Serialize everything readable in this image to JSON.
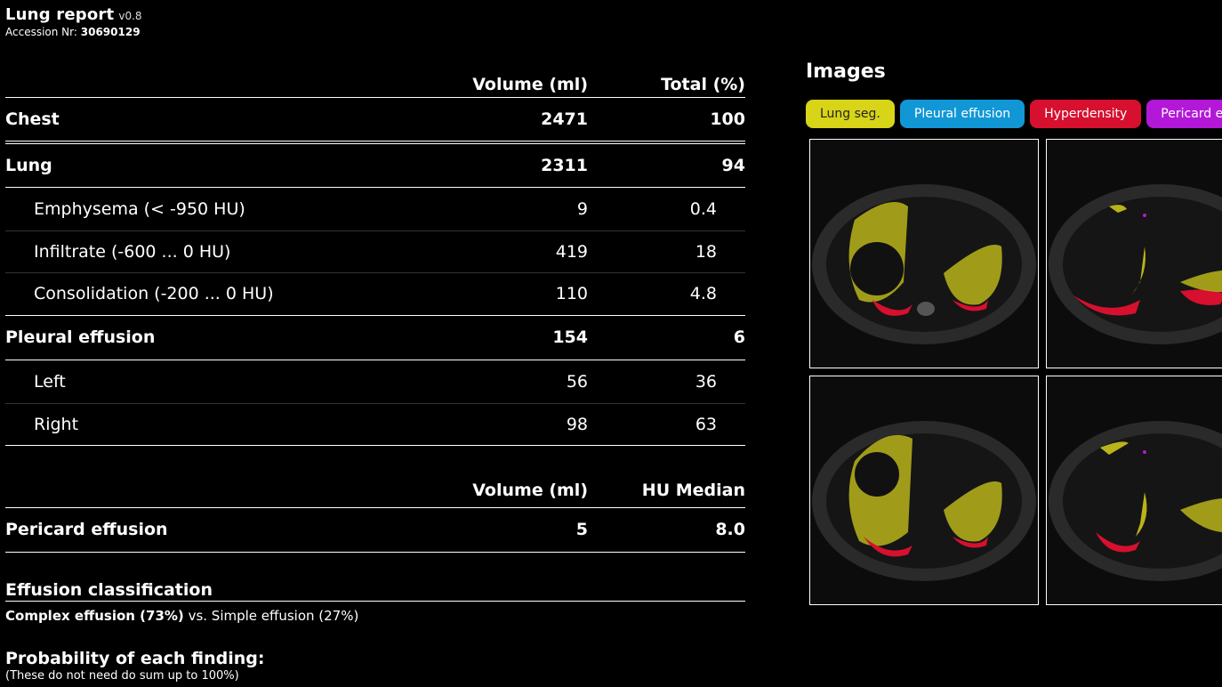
{
  "header": {
    "title": "Lung report",
    "version": "v0.8",
    "accession_label": "Accession Nr:",
    "accession_value": "30690129"
  },
  "volume_table": {
    "col_volume": "Volume (ml)",
    "col_total": "Total (%)",
    "rows": [
      {
        "label": "Chest",
        "volume": "2471",
        "total": "100",
        "level": "main"
      },
      {
        "label": "Lung",
        "volume": "2311",
        "total": "94",
        "level": "main"
      },
      {
        "label": "Emphysema (< -950 HU)",
        "volume": "9",
        "total": "0.4",
        "level": "sub"
      },
      {
        "label": "Infiltrate (-600 ... 0 HU)",
        "volume": "419",
        "total": "18",
        "level": "sub"
      },
      {
        "label": "Consolidation (-200 ... 0 HU)",
        "volume": "110",
        "total": "4.8",
        "level": "sub"
      },
      {
        "label": "Pleural effusion",
        "volume": "154",
        "total": "6",
        "level": "main"
      },
      {
        "label": "Left",
        "volume": "56",
        "total": "36",
        "level": "sub"
      },
      {
        "label": "Right",
        "volume": "98",
        "total": "63",
        "level": "sub"
      }
    ]
  },
  "pericard_table": {
    "col_volume": "Volume (ml)",
    "col_hu": "HU Median",
    "label": "Pericard effusion",
    "volume": "5",
    "hu": "8.0"
  },
  "effusion": {
    "title": "Effusion classification",
    "complex": "Complex effusion (73%)",
    "vs": " vs. Simple effusion (27%)"
  },
  "probability": {
    "title": "Probability of each finding:",
    "note": "(These do not need do sum up to 100%)"
  },
  "images": {
    "title": "Images",
    "chips": [
      {
        "label": "Lung seg.",
        "color": "#d8d418"
      },
      {
        "label": "Pleural effusion",
        "color": "#1197d6"
      },
      {
        "label": "Hyperdensity",
        "color": "#d6102e"
      },
      {
        "label": "Pericard effusion",
        "color": "#b318d8"
      }
    ]
  }
}
